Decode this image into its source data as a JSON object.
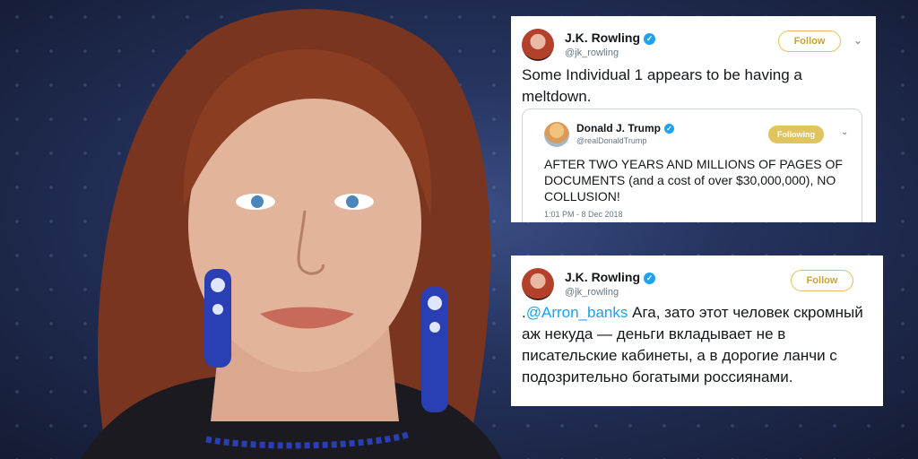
{
  "tweets": [
    {
      "name": "J.K. Rowling",
      "handle": "@jk_rowling",
      "follow_label": "Follow",
      "text": "Some Individual 1 appears to be having a meltdown.",
      "quoted": {
        "name": "Donald J. Trump",
        "handle": "@realDonaldTrump",
        "following_label": "Following",
        "text": "AFTER TWO YEARS AND MILLIONS OF PAGES OF DOCUMENTS (and a cost of over $30,000,000), NO COLLUSION!",
        "timestamp": "1:01 PM - 8 Dec 2018"
      }
    },
    {
      "name": "J.K. Rowling",
      "handle": "@jk_rowling",
      "follow_label": "Follow",
      "text_prefix": ".",
      "mention": "@Arron_banks",
      "text": " Ага, зато этот человек скромный аж некуда — деньги вкладывает не в писательские кабинеты, а в дорогие ланчи с подозрительно богатыми россиянами."
    }
  ],
  "icons": {
    "verified": "verified-badge-icon",
    "chevron": "chevron-down-icon"
  },
  "colors": {
    "accent": "#1da1f2",
    "follow_gold": "#e0c45f",
    "background": "#1b2440"
  }
}
